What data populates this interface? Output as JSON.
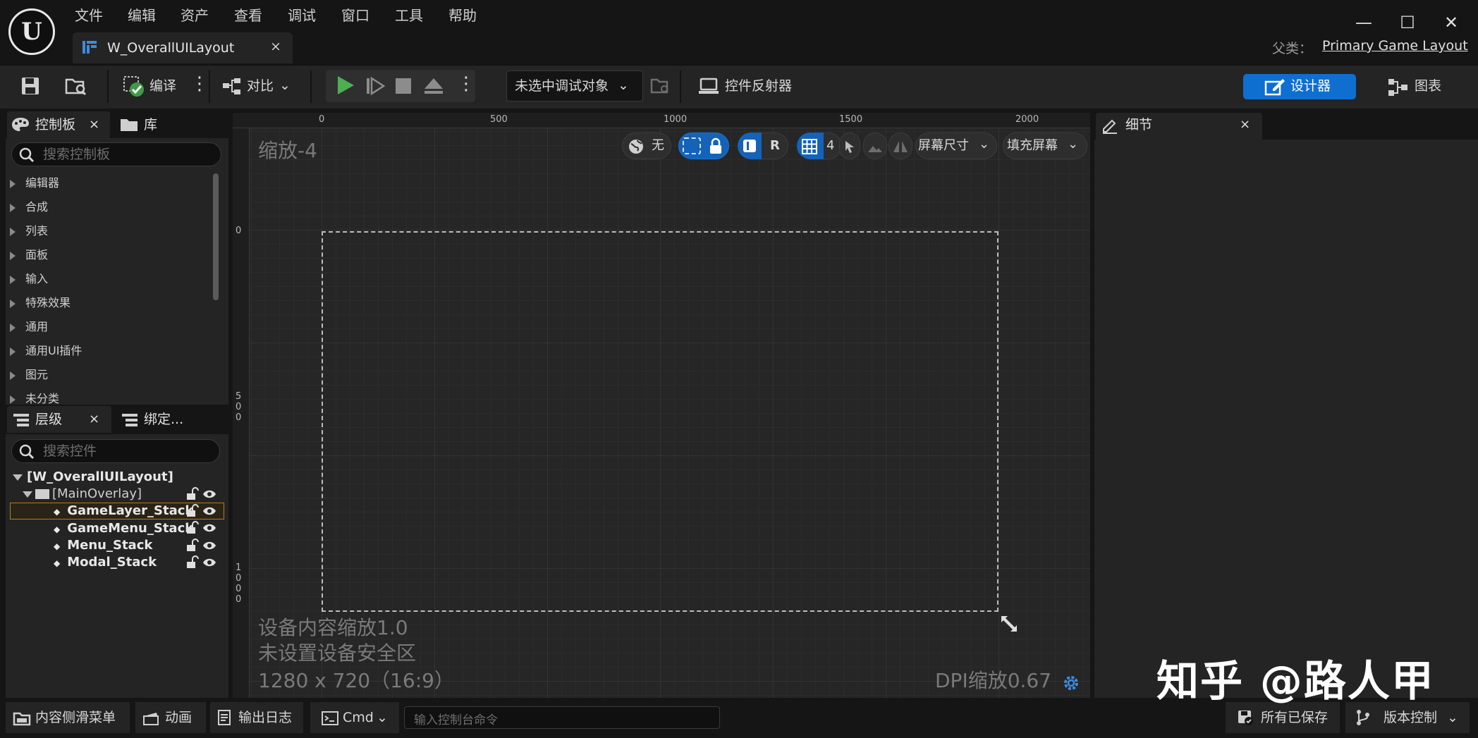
{
  "menu": {
    "items": [
      "文件",
      "编辑",
      "资产",
      "查看",
      "调试",
      "窗口",
      "工具",
      "帮助"
    ]
  },
  "document_tab": {
    "label": "W_OverallUILayout",
    "close": "×"
  },
  "parent_class": {
    "label": "父类：",
    "value": "Primary Game Layout"
  },
  "window_controls": {
    "minimize": "—",
    "maximize": "☐",
    "close": "✕"
  },
  "toolbar": {
    "compile_label": "编译",
    "diff_label": "对比",
    "debug_object": "未选中调试对象",
    "widget_reflector": "控件反射器",
    "designer": "设计器",
    "graph": "图表"
  },
  "palette": {
    "tab_label": "控制板",
    "library_tab": "库",
    "search_placeholder": "搜索控制板",
    "categories": [
      "编辑器",
      "合成",
      "列表",
      "面板",
      "输入",
      "特殊效果",
      "通用",
      "通用UI插件",
      "图元",
      "未分类"
    ]
  },
  "hierarchy": {
    "tab_label": "层级",
    "bind_tab": "绑定...",
    "search_placeholder": "搜索控件",
    "root": "[W_OverallUILayout]",
    "overlay": "[MainOverlay]",
    "children": [
      "GameLayer_Stack",
      "GameMenu_Stack",
      "Menu_Stack",
      "Modal_Stack"
    ]
  },
  "canvas": {
    "zoom": "缩放-4",
    "ruler_top": [
      "0",
      "500",
      "1000",
      "1500",
      "2000"
    ],
    "ruler_left": [
      "0",
      "5\n0\n0",
      "1\n0\n0\n0"
    ],
    "controls": {
      "none_label": "无",
      "r_label": "R",
      "grid_size": "4",
      "screen_size": "屏幕尺寸",
      "fill_screen": "填充屏幕"
    },
    "info": {
      "device_scale": "设备内容缩放1.0",
      "safe_zone": "未设置设备安全区",
      "resolution": "1280 x 720（16:9）"
    },
    "dpi": "DPI缩放0.67"
  },
  "details": {
    "tab_label": "细节",
    "close": "×"
  },
  "statusbar": {
    "content_drawer": "内容侧滑菜单",
    "animation": "动画",
    "output_log": "输出日志",
    "cmd": "Cmd",
    "cmd_placeholder": "输入控制台命令",
    "all_saved": "所有已保存",
    "source_control": "版本控制"
  },
  "watermark": "知乎 @路人甲",
  "colors": {
    "accent": "#0f6fd1",
    "play_green": "#4caf50"
  }
}
